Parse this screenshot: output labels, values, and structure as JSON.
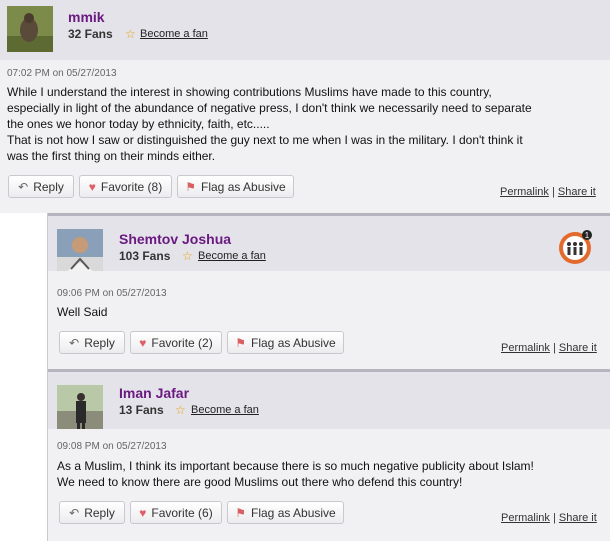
{
  "comments": [
    {
      "name": "mmik",
      "fans": "32 Fans",
      "become_fan": "Become a fan",
      "time": "07:02 PM",
      "date_prefix": "on",
      "date": "05/27/2013",
      "text_lines": [
        "While I understand the interest in showing contributions Muslims have made to this country,",
        "especially in light of the abundance of negative press, I don't think we necessarily need to separate",
        "the ones we honor today by ethnicity, faith, etc.....",
        "That is not how I saw or distinguished the guy next to me when I was in the military. I don't think it",
        "was the first thing on their minds either."
      ],
      "reply_label": "Reply",
      "favorite_label": "Favorite (8)",
      "flag_label": "Flag as Abusive",
      "permalink": "Permalink",
      "share": "Share it"
    },
    {
      "name": "Shemtov Joshua",
      "fans": "103 Fans",
      "become_fan": "Become a fan",
      "time": "09:06 PM",
      "date_prefix": "on",
      "date": "05/27/2013",
      "text_lines": [
        "Well Said"
      ],
      "reply_label": "Reply",
      "favorite_label": "Favorite (2)",
      "flag_label": "Flag as Abusive",
      "permalink": "Permalink",
      "share": "Share it",
      "badge_count": "1"
    },
    {
      "name": "Iman Jafar",
      "fans": "13 Fans",
      "become_fan": "Become a fan",
      "time": "09:08 PM",
      "date_prefix": "on",
      "date": "05/27/2013",
      "text_lines": [
        "As a Muslim, I think its important because there is so much negative publicity about Islam!",
        "We need to know there are good Muslims out there who defend this country!"
      ],
      "reply_label": "Reply",
      "favorite_label": "Favorite (6)",
      "flag_label": "Flag as Abusive",
      "permalink": "Permalink",
      "share": "Share it"
    }
  ],
  "separator": "|",
  "colors": {
    "username": "#6a1a80",
    "header_bg": "#e4e3ea",
    "body_bg": "#f1f1f4",
    "star": "#e8a400"
  }
}
